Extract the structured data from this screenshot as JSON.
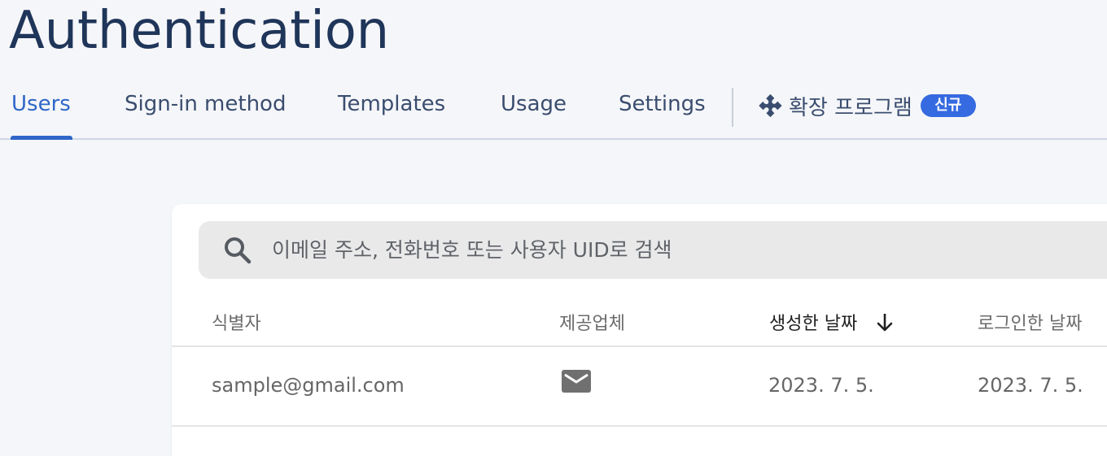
{
  "header": {
    "title": "Authentication"
  },
  "tabs": [
    {
      "label": "Users",
      "active": true
    },
    {
      "label": "Sign-in method",
      "active": false
    },
    {
      "label": "Templates",
      "active": false
    },
    {
      "label": "Usage",
      "active": false
    },
    {
      "label": "Settings",
      "active": false
    }
  ],
  "extension_tab": {
    "label": "확장 프로그램",
    "badge": "신규",
    "icon": "extension-icon"
  },
  "search": {
    "placeholder": "이메일 주소, 전화번호 또는 사용자 UID로 검색",
    "value": "",
    "icon": "search-icon"
  },
  "table": {
    "columns": [
      {
        "label": "식별자"
      },
      {
        "label": "제공업체"
      },
      {
        "label": "생성한 날짜",
        "sorted": "descending",
        "sort_icon": "arrow-down-icon"
      },
      {
        "label": "로그인한 날짜"
      }
    ],
    "rows": [
      {
        "identifier": "sample@gmail.com",
        "provider_icon": "email-icon",
        "created": "2023. 7. 5.",
        "signed_in": "2023. 7. 5."
      }
    ]
  },
  "colors": {
    "accent": "#2f66c8",
    "badge": "#356ae0",
    "title": "#1f3559",
    "page_background": "#f5f6f9"
  }
}
